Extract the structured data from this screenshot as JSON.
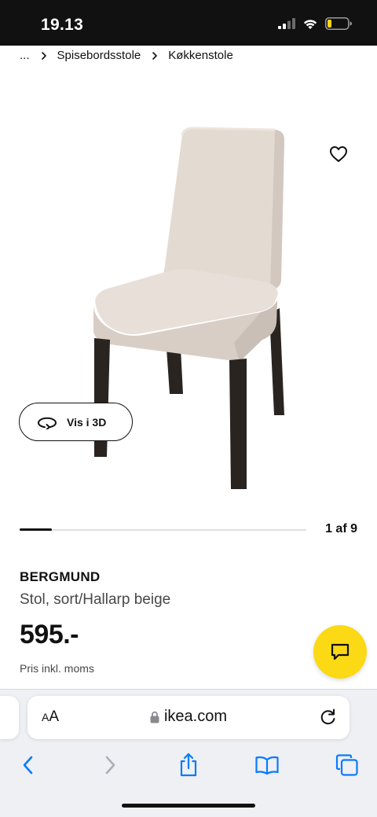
{
  "status": {
    "time": "19.13"
  },
  "breadcrumb": {
    "ellipsis": "...",
    "items": [
      "Spisebordsstole",
      "Køkkenstole"
    ]
  },
  "gallery": {
    "view_3d_label": "Vis i 3D",
    "pager": "1 af 9",
    "progress": 0.111
  },
  "product": {
    "name": "BERGMUND",
    "description": "Stol, sort/Hallarp beige",
    "price": "595.-",
    "price_note": "Pris inkl. moms"
  },
  "browser": {
    "text_size_label_small": "A",
    "text_size_label": "A",
    "url": "ikea.com"
  },
  "colors": {
    "chat_button": "#fbd914",
    "accent_blue": "#0a7aff",
    "chair_fabric": "#e3dad2",
    "chair_legs": "#2a2421"
  },
  "icons": {
    "favorite": "heart-icon",
    "view_3d": "rotate-3d-icon",
    "chat": "chat-bubble-icon",
    "lock": "lock-icon",
    "reload": "reload-icon",
    "back": "chevron-left-icon",
    "forward": "chevron-right-icon",
    "share": "share-icon",
    "bookmarks": "book-icon",
    "tabs": "tabs-icon"
  }
}
